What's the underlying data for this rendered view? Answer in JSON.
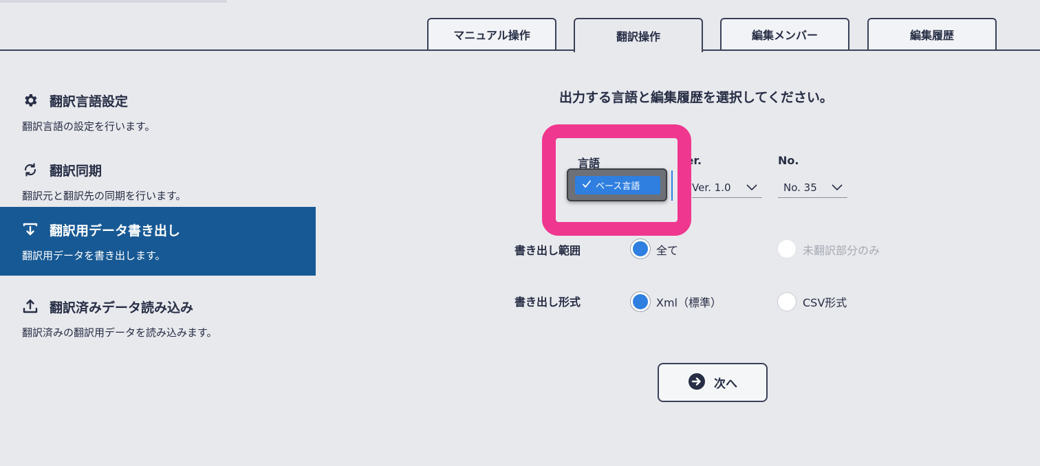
{
  "tabs": [
    {
      "label": "マニュアル操作",
      "active": false
    },
    {
      "label": "翻訳操作",
      "active": true
    },
    {
      "label": "編集メンバー",
      "active": false
    },
    {
      "label": "編集履歴",
      "active": false
    }
  ],
  "sidebar": {
    "items": [
      {
        "icon": "gear-icon",
        "title": "翻訳言語設定",
        "description": "翻訳言語の設定を行います。",
        "active": false
      },
      {
        "icon": "sync-icon",
        "title": "翻訳同期",
        "description": "翻訳元と翻訳先の同期を行います。",
        "active": false
      },
      {
        "icon": "download-icon",
        "title": "翻訳用データ書き出し",
        "description": "翻訳用データを書き出します。",
        "active": true
      },
      {
        "icon": "upload-icon",
        "title": "翻訳済みデータ読み込み",
        "description": "翻訳済みの翻訳用データを読み込みます。",
        "active": false
      }
    ]
  },
  "main": {
    "instruction": "出力する言語と編集履歴を選択してください。",
    "language": {
      "label": "言語",
      "options": [
        "ベース言語"
      ],
      "selected": "ベース言語"
    },
    "version": {
      "label": "Ver.",
      "value": "Ver. 1.0"
    },
    "number": {
      "label": "No.",
      "value": "No. 35"
    },
    "export_range": {
      "label": "書き出し範囲",
      "options": [
        {
          "label": "全て",
          "checked": true,
          "disabled": false
        },
        {
          "label": "未翻訳部分のみ",
          "checked": false,
          "disabled": true
        }
      ]
    },
    "export_format": {
      "label": "書き出し形式",
      "options": [
        {
          "label": "Xml（標準）",
          "checked": true,
          "disabled": false
        },
        {
          "label": "CSV形式",
          "checked": false,
          "disabled": false
        }
      ]
    },
    "next_button": {
      "label": "次へ",
      "icon": "arrow-right-circle-icon"
    }
  },
  "colors": {
    "background": "#e8e9ed",
    "text": "#262d44",
    "sidebar_active": "#175994",
    "accent_blue": "#2f7fe0",
    "highlight": "#f0378f"
  }
}
